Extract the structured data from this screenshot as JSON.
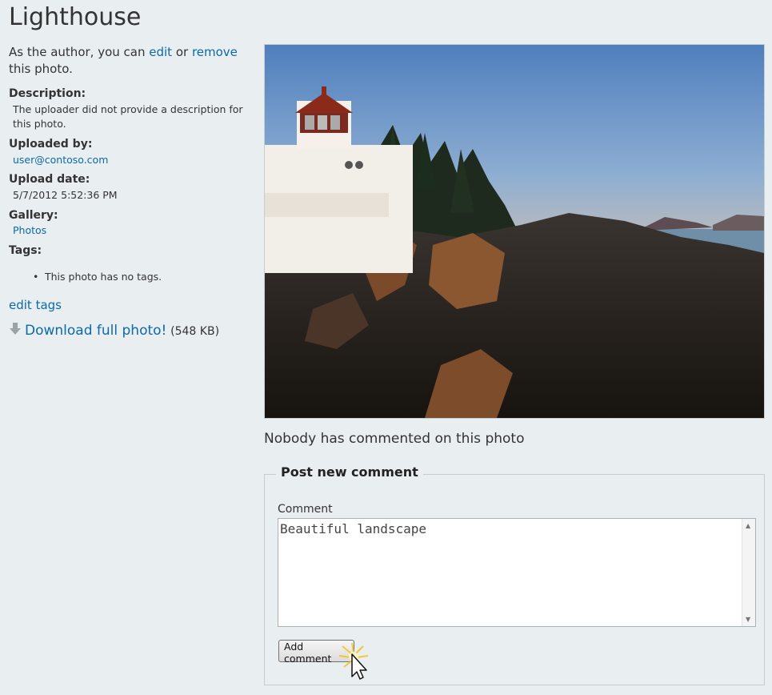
{
  "page": {
    "title": "Lighthouse",
    "author_intro_prefix": "As the author, you can ",
    "edit_link": "edit",
    "or_text": " or ",
    "remove_link": "remove",
    "author_intro_suffix": "this photo."
  },
  "details": {
    "description_label": "Description:",
    "description_value": "The uploader did not provide a description for this photo.",
    "uploaded_by_label": "Uploaded by:",
    "uploaded_by_value": "user@contoso.com",
    "upload_date_label": "Upload date:",
    "upload_date_value": "5/7/2012 5:52:36 PM",
    "gallery_label": "Gallery:",
    "gallery_value": "Photos",
    "tags_label": "Tags:",
    "tags_empty": "This photo has no tags.",
    "edit_tags_link": "edit tags",
    "download_link": "Download full photo!",
    "download_size": "(548 KB)"
  },
  "icons": {
    "download": "download-arrow-icon",
    "cursor": "mouse-pointer-icon"
  },
  "comments": {
    "empty_message": "Nobody has commented on this photo",
    "form_legend": "Post new comment",
    "comment_label": "Comment",
    "comment_value": "Beautiful landscape",
    "submit_label": "Add comment"
  },
  "colors": {
    "background": "#e9eef0",
    "link": "#0c6aa8"
  }
}
